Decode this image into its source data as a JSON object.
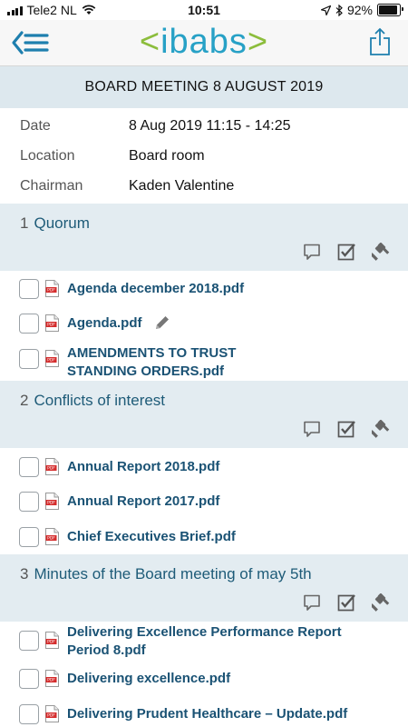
{
  "status_bar": {
    "carrier": "Tele2 NL",
    "time": "10:51",
    "battery_percent": "92%",
    "battery_level": 0.92
  },
  "nav": {
    "logo_left": "<",
    "logo_name": "ibabs",
    "logo_right": ">"
  },
  "meeting": {
    "title": "BOARD MEETING 8 AUGUST 2019",
    "details": [
      {
        "label": "Date",
        "value": "8 Aug 2019 11:15 - 14:25"
      },
      {
        "label": "Location",
        "value": "Board room"
      },
      {
        "label": "Chairman",
        "value": "Kaden Valentine"
      }
    ]
  },
  "sections": [
    {
      "number": "1",
      "title": "Quorum",
      "documents": [
        {
          "line1": "Agenda december 2018.pdf",
          "line2": "",
          "annotated": false
        },
        {
          "line1": "Agenda.pdf",
          "line2": "",
          "annotated": true
        },
        {
          "line1": "AMENDMENTS TO TRUST",
          "line2": "STANDING ORDERS.pdf",
          "annotated": false
        }
      ]
    },
    {
      "number": "2",
      "title": "Conflicts of interest",
      "documents": [
        {
          "line1": "Annual Report 2018.pdf",
          "line2": "",
          "annotated": false
        },
        {
          "line1": "Annual Report 2017.pdf",
          "line2": "",
          "annotated": false
        },
        {
          "line1": "Chief Executives Brief.pdf",
          "line2": "",
          "annotated": false
        }
      ]
    },
    {
      "number": "3",
      "title": "Minutes of the Board meeting of may 5th",
      "documents": [
        {
          "line1": "Delivering Excellence Performance Report",
          "line2": "Period 8.pdf",
          "annotated": false
        },
        {
          "line1": "Delivering excellence.pdf",
          "line2": "",
          "annotated": false
        },
        {
          "line1": "Delivering Prudent Healthcare – Update.pdf",
          "line2": "",
          "annotated": false
        }
      ]
    }
  ],
  "icons": {
    "menu": "menu-back-icon",
    "share": "share-icon",
    "comment": "comment-icon",
    "vote": "checkbox-vote-icon",
    "decision": "gavel-icon",
    "document": "pdf-file-icon",
    "annotation": "pencil-icon"
  },
  "colors": {
    "brand_blue": "#27a1c6",
    "brand_green": "#8cbd3c",
    "doc_link": "#1a5274",
    "section_bg": "#e3ecf1"
  }
}
